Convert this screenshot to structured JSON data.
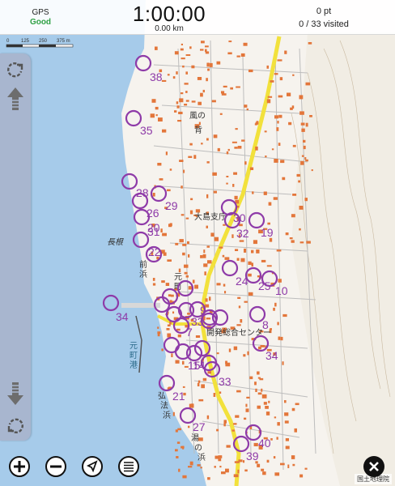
{
  "status_bar": {
    "gps_label": "GPS",
    "gps_status": "Good",
    "timer": "1:00:00",
    "distance": "0.00 km",
    "points": "0 pt",
    "visited": "0 / 33 visited"
  },
  "scale_bar": {
    "ticks": [
      "0",
      "125",
      "250",
      "375 m"
    ]
  },
  "map": {
    "attribution": "国土地理院",
    "labels": {
      "kazenose": "風の背",
      "oshima": "大島支庁",
      "nagane": "長根",
      "maehama": "前浜",
      "motomachi": "元町",
      "motomachi_port": "元町港",
      "kaihatsu_center": "開発総合センター",
      "kobohama": "弘法浜",
      "yunohama": "湯の浜"
    },
    "checkpoints": [
      "38",
      "35",
      "28",
      "29",
      "26",
      "20",
      "31",
      "30",
      "32",
      "19",
      "22",
      "24",
      "25",
      "10",
      "34",
      "8",
      "7",
      "33",
      "9",
      "34",
      "15",
      "14",
      "33",
      "21",
      "27",
      "40",
      "39"
    ]
  },
  "bottom_bar": {
    "zoom_in": "zoom in",
    "zoom_out": "zoom out",
    "locate": "locate",
    "menu": "menu",
    "close": "close"
  },
  "colors": {
    "sea": "#a6cbea",
    "checkpoint": "#8e3aa8",
    "main_road": "#f2e13c",
    "building": "#e3763a",
    "gps_good": "#2ea043",
    "panel": "#a8b6cf"
  },
  "icons": {
    "refresh_top": "refresh-icon",
    "arrow_up": "arrow-up-icon",
    "arrow_down": "arrow-down-icon",
    "refresh_bottom": "refresh-icon",
    "zoom_in": "plus-circle-icon",
    "zoom_out": "minus-circle-icon",
    "locate": "navigation-arrow-icon",
    "menu": "menu-icon",
    "close": "close-icon"
  }
}
